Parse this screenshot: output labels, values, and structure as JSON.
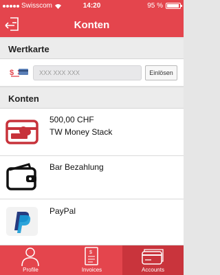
{
  "status": {
    "carrier": "Swisscom",
    "time": "14:20",
    "battery": "95 %"
  },
  "nav": {
    "title": "Konten",
    "logout_icon": "logout-icon"
  },
  "wertkarte": {
    "header": "Wertkarte",
    "input_placeholder": "XXX XXX XXX",
    "redeem_label": "Einlösen",
    "icon": "voucher-card-icon"
  },
  "konten": {
    "header": "Konten",
    "accounts": [
      {
        "line1": "500,00 CHF",
        "line2": "TW Money Stack",
        "icon": "money-stack-card-icon"
      },
      {
        "line1": "Bar Bezahlung",
        "line2": "",
        "icon": "wallet-icon"
      },
      {
        "line1": "PayPal",
        "line2": "",
        "icon": "paypal-icon"
      }
    ]
  },
  "tabs": [
    {
      "label": "Profile",
      "icon": "profile-icon",
      "active": false
    },
    {
      "label": "Invoices",
      "icon": "invoice-icon",
      "active": false
    },
    {
      "label": "Accounts",
      "icon": "accounts-icon",
      "active": true
    }
  ],
  "colors": {
    "brand": "#e4454d",
    "active_tab": "#c9343c",
    "paypal_dark": "#253b80",
    "paypal_light": "#179bd7"
  }
}
